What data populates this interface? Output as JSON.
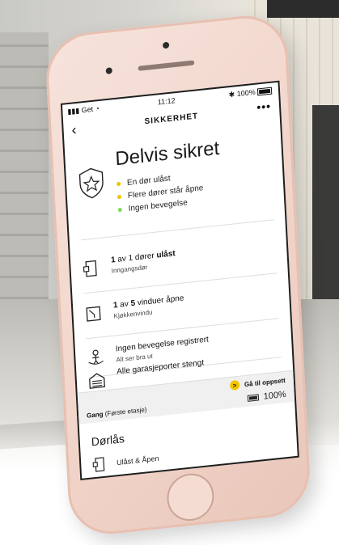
{
  "status_bar": {
    "carrier": "Get",
    "time": "11:12",
    "battery": "100%"
  },
  "header": {
    "title": "SIKKERHET",
    "back_icon": "chevron-left-icon",
    "more_label": "•••"
  },
  "summary": {
    "title": "Delvis sikret",
    "items": [
      {
        "text": "En dør ulåst",
        "color": "#f2c500"
      },
      {
        "text": "Flere dører står åpne",
        "color": "#f2c500"
      },
      {
        "text": "Ingen bevegelse",
        "color": "#7ed957"
      }
    ]
  },
  "status_items": [
    {
      "icon": "door-icon",
      "count": "1",
      "mid": " av 1 dører ",
      "strong": "ulåst",
      "sub": "Inngangsdør"
    },
    {
      "icon": "window-icon",
      "count": "1",
      "mid": " av ",
      "strong": "5",
      "tail": " vinduer åpne",
      "sub": "Kjøkkenvindu"
    },
    {
      "icon": "motion-icon",
      "title": "Ingen bevegelse registrert",
      "sub": "Alt ser bra ut"
    },
    {
      "icon": "garage-icon",
      "title": "Alle garasjeporter stengt",
      "sub": ""
    }
  ],
  "gray_bar": {
    "goto_label": "Gå til oppsett",
    "room_bold": "Gang",
    "room_rest": " (Første etasje)",
    "battery": "100%"
  },
  "lock_section": {
    "title": "Dørlås",
    "item_label": "Ulåst & Åpen"
  }
}
